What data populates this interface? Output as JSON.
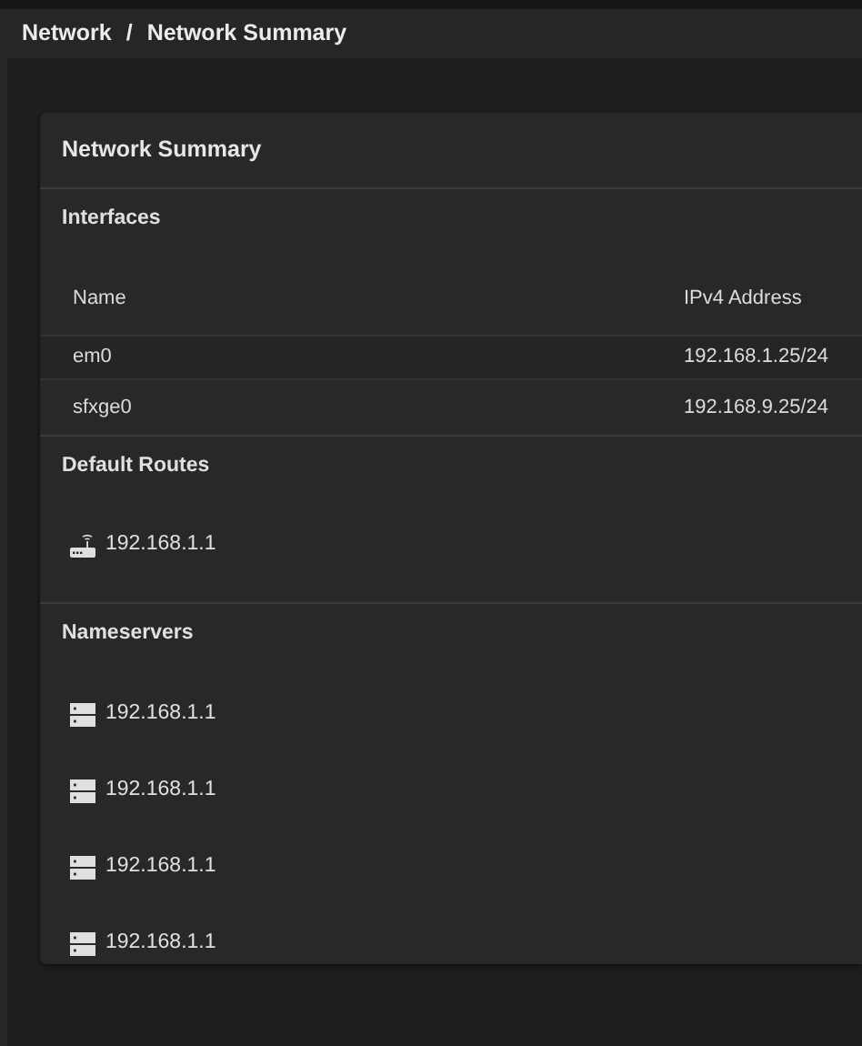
{
  "breadcrumb": [
    "Network",
    "/",
    "Network Summary"
  ],
  "card": {
    "title": "Network Summary",
    "sections": [
      {
        "kind": "table",
        "title": "Interfaces",
        "columns": [
          "Name",
          "IPv4 Address"
        ],
        "rows": [
          {
            "cells": [
              "em0",
              "192.168.1.25/24"
            ]
          },
          {
            "cells": [
              "sfxge0",
              "192.168.9.25/24"
            ]
          }
        ]
      },
      {
        "kind": "routes",
        "title": "Default Routes",
        "items": [
          "192.168.1.1"
        ]
      },
      {
        "kind": "nameservers",
        "title": "Nameservers",
        "items": [
          "192.168.1.1",
          "192.168.1.1",
          "192.168.1.1",
          "192.168.1.1"
        ]
      }
    ]
  }
}
